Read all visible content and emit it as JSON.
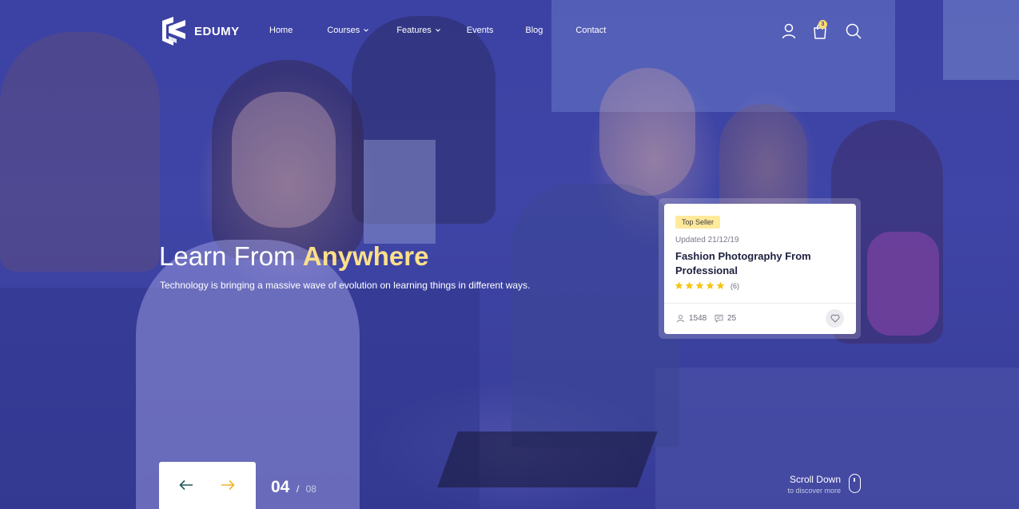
{
  "brand": {
    "name": "EDUMY",
    "logo_icon": "edumy-logo-icon"
  },
  "nav": {
    "items": [
      {
        "label": "Home",
        "has_dropdown": false
      },
      {
        "label": "Courses",
        "has_dropdown": true
      },
      {
        "label": "Features",
        "has_dropdown": true
      },
      {
        "label": "Events",
        "has_dropdown": false
      },
      {
        "label": "Blog",
        "has_dropdown": false
      },
      {
        "label": "Contact",
        "has_dropdown": false
      }
    ]
  },
  "header_icons": {
    "user": "user-icon",
    "cart": "cart-icon",
    "search": "search-icon",
    "cart_count": "3"
  },
  "hero": {
    "title_prefix": "Learn From",
    "title_accent": "Anywhere",
    "subtitle": "Technology is bringing a massive wave of evolution on learning things in different ways."
  },
  "course_card": {
    "badge": "Top Seller",
    "updated": "Updated 21/12/19",
    "title": "Fashion Photography From Professional",
    "rating_stars": 5,
    "rating_count": "(6)",
    "students": "1548",
    "comments": "25"
  },
  "slider": {
    "current": "04",
    "separator": "/",
    "total": "08"
  },
  "scroll_hint": {
    "title": "Scroll Down",
    "subtitle": "to discover more"
  },
  "colors": {
    "overlay": "#3b42a3",
    "accent": "#ffe08a",
    "badge_bg": "#ffe99b",
    "star": "#f5c518",
    "next_arrow": "#f0b429",
    "prev_arrow": "#1f5a5a"
  }
}
